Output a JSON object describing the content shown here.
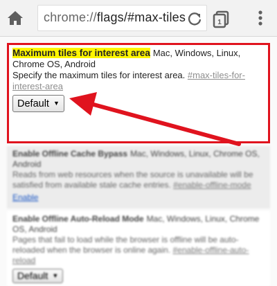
{
  "browser": {
    "url_host": "chrome://",
    "url_path": "flags/#max-tiles",
    "tab_count": "1"
  },
  "experiments": [
    {
      "name": "Maximum tiles for interest area",
      "platforms": "Mac, Windows, Linux, Chrome OS, Android",
      "description": "Specify the maximum tiles for interest area.",
      "anchor": "#max-tiles-for-interest-area",
      "control": "Default"
    },
    {
      "name": "Enable Offline Cache Bypass",
      "platforms": "Mac, Windows, Linux, Chrome OS, Android",
      "description": "Reads from web resources when the source is unavailable will be satisfied from available stale cache entries.",
      "anchor": "#enable-offline-mode",
      "control": "Enable"
    },
    {
      "name": "Enable Offline Auto-Reload Mode",
      "platforms": "Mac, Windows, Linux, Chrome OS, Android",
      "description": "Pages that fail to load while the browser is offline will be auto-reloaded when the browser is online again.",
      "anchor": "#enable-offline-auto-reload",
      "control": "Default"
    }
  ],
  "colors": {
    "annotation_red": "#e0131e",
    "highlight_yellow": "#fdf600",
    "link_blue": "#1a56c4"
  }
}
